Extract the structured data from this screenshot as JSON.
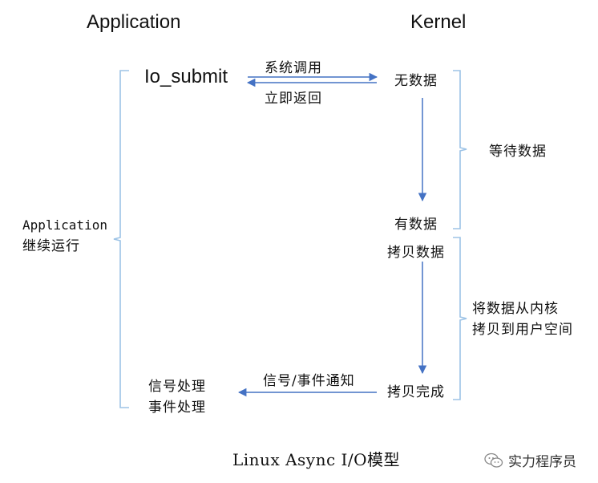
{
  "headers": {
    "application": "Application",
    "kernel": "Kernel"
  },
  "app": {
    "io_submit": "Io_submit",
    "continue_line1": "Application",
    "continue_line2": "继续运行",
    "handle_line1": "信号处理",
    "handle_line2": "事件处理"
  },
  "arrows": {
    "syscall": "系统调用",
    "return_now": "立即返回",
    "notify": "信号/事件通知"
  },
  "kernel": {
    "no_data": "无数据",
    "has_data": "有数据",
    "copy_data": "拷贝数据",
    "copy_done": "拷贝完成"
  },
  "phases": {
    "wait_data": "等待数据",
    "copy_line1": "将数据从内核",
    "copy_line2": "拷贝到用户空间"
  },
  "caption": "Linux Async I/O模型",
  "watermark": {
    "icon": "wechat-icon",
    "text": "实力程序员"
  },
  "colors": {
    "arrow": "#4472c4",
    "bracket": "#9dc3e6",
    "text": "#111111"
  }
}
